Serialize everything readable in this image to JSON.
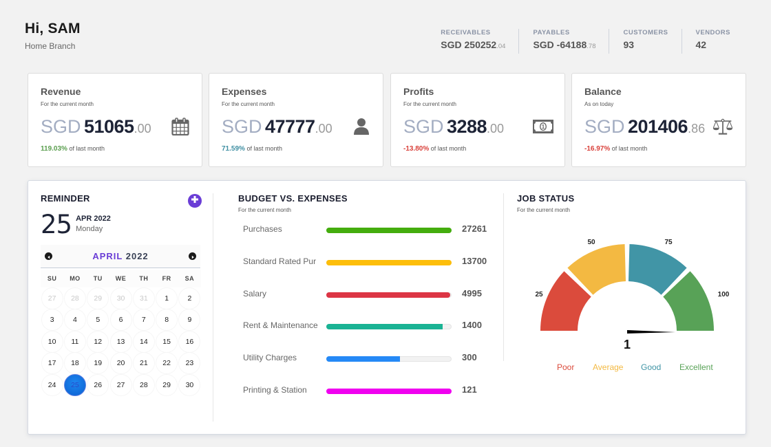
{
  "header": {
    "greeting": "Hi, SAM",
    "branch": "Home Branch"
  },
  "stats": [
    {
      "label": "RECEIVABLES",
      "value": "SGD 250252",
      "decimal": ".04"
    },
    {
      "label": "PAYABLES",
      "value": "SGD -64188",
      "decimal": ".78"
    },
    {
      "label": "CUSTOMERS",
      "value": "93",
      "decimal": ""
    },
    {
      "label": "VENDORS",
      "value": "42",
      "decimal": ""
    }
  ],
  "cards": [
    {
      "title": "Revenue",
      "subtitle": "For the current month",
      "currency": "SGD",
      "integer": "51065",
      "decimal": ".00",
      "pct": "119.03%",
      "pct_suffix": "of last month",
      "pct_color": "#5a9e4e",
      "icon": "calendar-icon"
    },
    {
      "title": "Expenses",
      "subtitle": "For the current month",
      "currency": "SGD",
      "integer": "47777",
      "decimal": ".00",
      "pct": "71.59%",
      "pct_suffix": "of last month",
      "pct_color": "#3f8fa3",
      "icon": "user-icon"
    },
    {
      "title": "Profits",
      "subtitle": "For the current month",
      "currency": "SGD",
      "integer": "3288",
      "decimal": ".00",
      "pct": "-13.80%",
      "pct_suffix": "of last month",
      "pct_color": "#d9403a",
      "icon": "money-bill-icon"
    },
    {
      "title": "Balance",
      "subtitle": "As on today",
      "currency": "SGD",
      "integer": "201406",
      "decimal": ".86",
      "pct": "-16.97%",
      "pct_suffix": "of last month",
      "pct_color": "#d9403a",
      "icon": "balance-scale-icon"
    }
  ],
  "reminder": {
    "title": "REMINDER",
    "add_icon": "plus-circle-icon",
    "day": "25",
    "month_year": "APR 2022",
    "weekday": "Monday",
    "calendar": {
      "month": "APRIL",
      "year": "2022",
      "weekdays": [
        "SU",
        "MO",
        "TU",
        "WE",
        "TH",
        "FR",
        "SA"
      ],
      "days": [
        {
          "d": "27",
          "muted": true
        },
        {
          "d": "28",
          "muted": true
        },
        {
          "d": "29",
          "muted": true
        },
        {
          "d": "30",
          "muted": true
        },
        {
          "d": "31",
          "muted": true
        },
        {
          "d": "1"
        },
        {
          "d": "2"
        },
        {
          "d": "3"
        },
        {
          "d": "4"
        },
        {
          "d": "5"
        },
        {
          "d": "6"
        },
        {
          "d": "7"
        },
        {
          "d": "8"
        },
        {
          "d": "9"
        },
        {
          "d": "10"
        },
        {
          "d": "11"
        },
        {
          "d": "12"
        },
        {
          "d": "13"
        },
        {
          "d": "14"
        },
        {
          "d": "15"
        },
        {
          "d": "16"
        },
        {
          "d": "17"
        },
        {
          "d": "18"
        },
        {
          "d": "19"
        },
        {
          "d": "20"
        },
        {
          "d": "21"
        },
        {
          "d": "22"
        },
        {
          "d": "23"
        },
        {
          "d": "24"
        },
        {
          "d": "25",
          "selected": true
        },
        {
          "d": "26"
        },
        {
          "d": "27"
        },
        {
          "d": "28"
        },
        {
          "d": "29"
        },
        {
          "d": "30"
        }
      ]
    }
  },
  "budget": {
    "title": "BUDGET VS. EXPENSES",
    "subtitle": "For the current month",
    "items": [
      {
        "label": "Purchases",
        "value": "27261",
        "progress": 1.0,
        "color": "#44ad0e"
      },
      {
        "label": "Standard Rated Pur",
        "value": "13700",
        "progress": 1.0,
        "color": "#fdbe0b"
      },
      {
        "label": "Salary",
        "value": "4995",
        "progress": 0.99,
        "color": "#dc3545"
      },
      {
        "label": "Rent & Maintenance",
        "value": "1400",
        "progress": 0.93,
        "color": "#1ab394"
      },
      {
        "label": "Utility Charges",
        "value": "300",
        "progress": 0.59,
        "color": "#2589f6"
      },
      {
        "label": "Printing & Station",
        "value": "121",
        "progress": 1.0,
        "color": "#f000f0"
      }
    ]
  },
  "job_status": {
    "title": "JOB STATUS",
    "subtitle": "For the current month",
    "value": "1",
    "needle_value": 1,
    "ticks": [
      "25",
      "50",
      "75",
      "100"
    ],
    "segments": [
      {
        "label": "Poor",
        "color": "#db4b3c"
      },
      {
        "label": "Average",
        "color": "#f3b942"
      },
      {
        "label": "Good",
        "color": "#4195a6"
      },
      {
        "label": "Excellent",
        "color": "#58a257"
      }
    ]
  }
}
